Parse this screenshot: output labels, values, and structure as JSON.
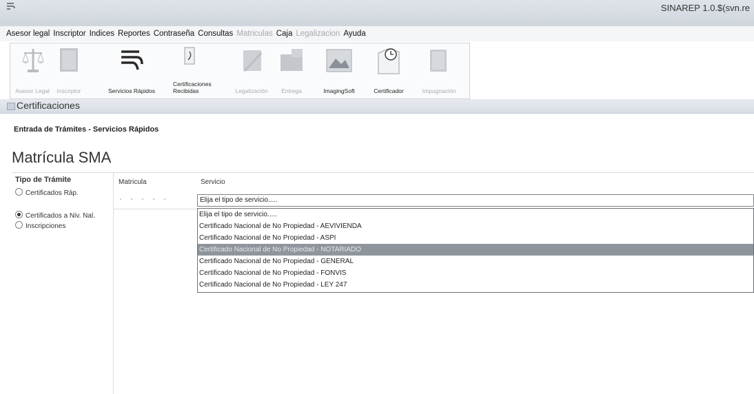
{
  "window": {
    "app_icon": "RI-logo-icon",
    "title": "SINAREP 1.0.$(svn.re"
  },
  "menu": [
    {
      "label": "Asesor legal",
      "enabled": true,
      "underline": "A"
    },
    {
      "label": "Inscriptor",
      "enabled": true
    },
    {
      "label": "Indices",
      "enabled": true
    },
    {
      "label": "Reportes",
      "enabled": true
    },
    {
      "label": "Contraseña",
      "enabled": true
    },
    {
      "label": "Consultas",
      "enabled": true
    },
    {
      "label": "Matriculas",
      "enabled": false
    },
    {
      "label": "Caja",
      "enabled": true
    },
    {
      "label": "Legalizacion",
      "enabled": false
    },
    {
      "label": "Ayuda",
      "enabled": true
    }
  ],
  "toolbar": [
    {
      "label": "Asesor Legal",
      "icon": "scales-icon",
      "enabled": false
    },
    {
      "label": "Inscriptor",
      "icon": "book-icon",
      "enabled": false
    },
    {
      "label": "Servicios Rápidos",
      "icon": "ri-logo-icon",
      "enabled": true
    },
    {
      "label": "Certificaciones Recibidas",
      "icon": "document-icon",
      "enabled": true
    },
    {
      "label": "Legalización",
      "icon": "stamp-icon",
      "enabled": false
    },
    {
      "label": "Entrega",
      "icon": "delivery-icon",
      "enabled": false
    },
    {
      "label": "ImagingSoft",
      "icon": "image-icon",
      "enabled": true
    },
    {
      "label": "Certificador",
      "icon": "clock-document-icon",
      "enabled": true
    },
    {
      "label": "Impugnación",
      "icon": "folder-icon",
      "enabled": false
    }
  ],
  "panel": {
    "title": "Certificaciones",
    "icon": "panel-icon"
  },
  "breadcrumb": "Entrada de Trámites - Servicios Rápidos",
  "page_title": "Matrícula SMA",
  "tipo_tramite": {
    "title": "Tipo de Trámite",
    "options": [
      {
        "label": "Certificados Ráp.",
        "selected": false
      },
      {
        "label": "Certificados a Niv. Nal.",
        "selected": true
      },
      {
        "label": "Inscripciones",
        "selected": false
      }
    ]
  },
  "grid": {
    "col_matricula": "Matricula",
    "col_servicio": "Servicio",
    "matricula_value": ". . . . ."
  },
  "servicio_select": {
    "value": "Elija el tipo de servicio.....",
    "options": [
      "Elija el tipo de servicio.....",
      "Certificado Nacional de No Propiedad - AEVIVIENDA",
      "Certificado Nacional de No Propiedad - ASPI",
      "Certificado Nacional de No Propiedad - NOTARIADO",
      "Certificado Nacional de No Propiedad - GENERAL",
      "Certificado Nacional de No Propiedad - FONVIS",
      "Certificado Nacional de No Propiedad - LEY 247"
    ],
    "highlighted_index": 3
  },
  "colors": {
    "highlight": "#8f959c",
    "disabled_text": "#a5a9ae",
    "titlebar": "#cfd5dc"
  }
}
